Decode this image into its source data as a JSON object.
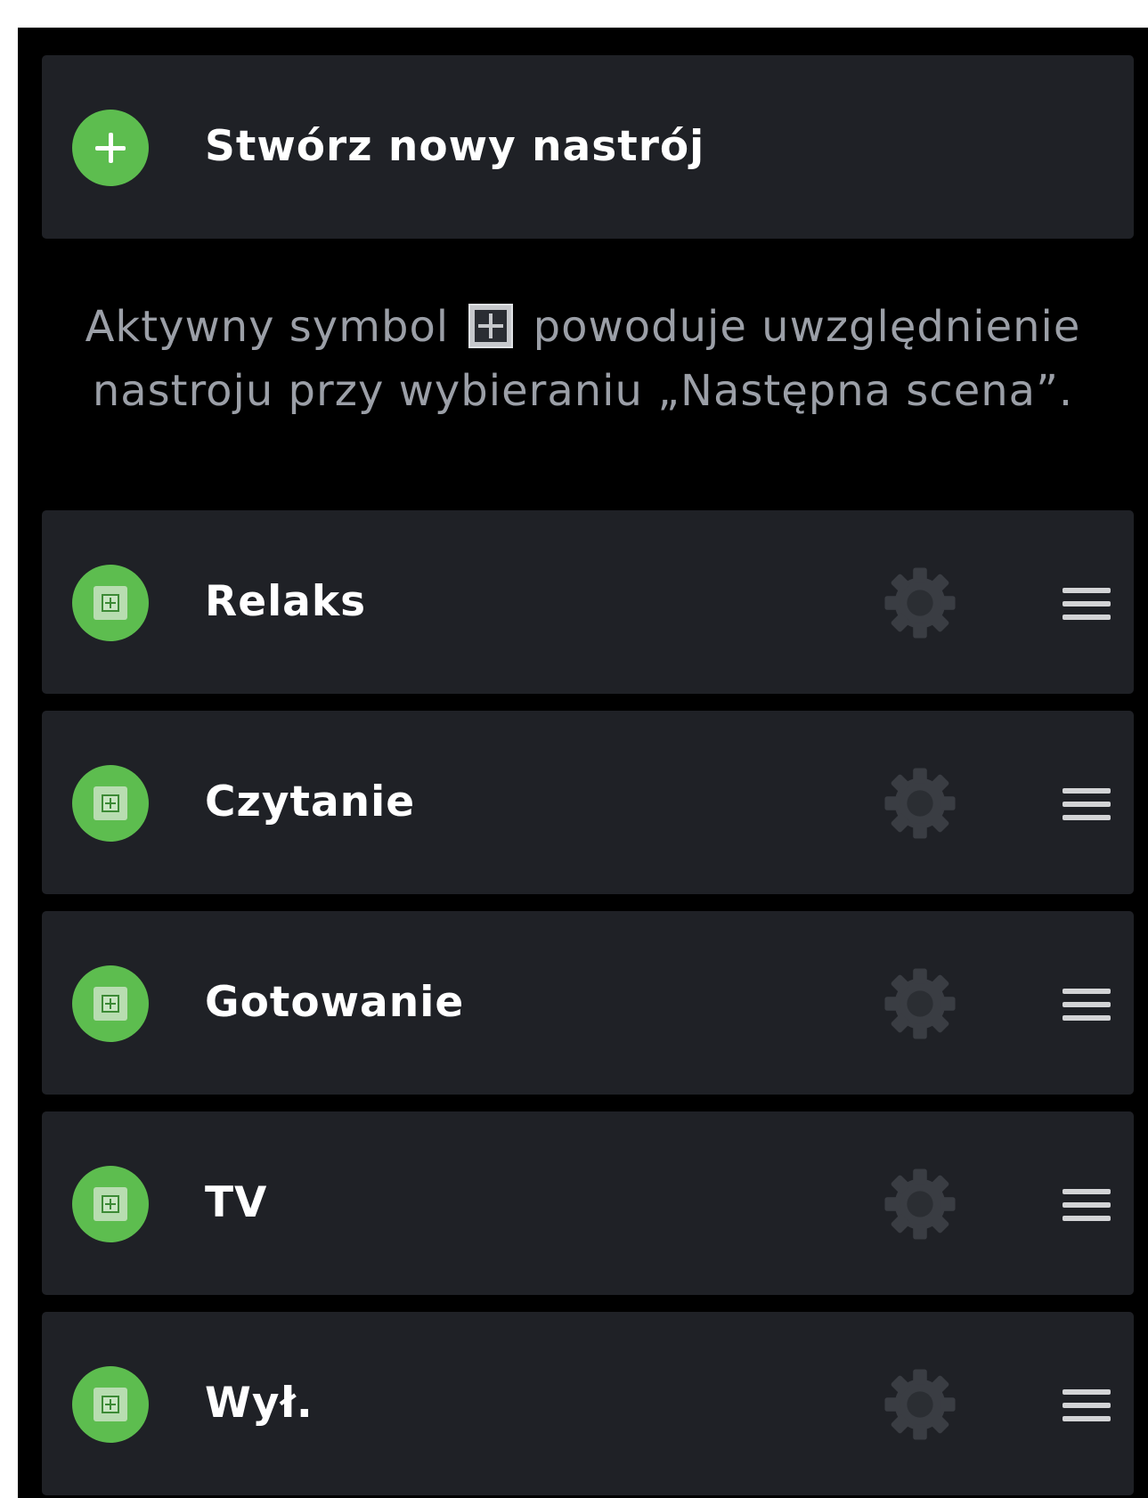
{
  "create": {
    "label": "Stwórz nowy nastrój"
  },
  "info": {
    "line1_before": "Aktywny symbol",
    "line1_after": "powoduje uwzględnienie",
    "line2": "nastroju przy wybieraniu „Następna scena”."
  },
  "moods": [
    {
      "label": "Relaks"
    },
    {
      "label": "Czytanie"
    },
    {
      "label": "Gotowanie"
    },
    {
      "label": "TV"
    },
    {
      "label": "Wył."
    }
  ],
  "colors": {
    "accent_green": "#5dbd4f",
    "card_background": "#1f2126",
    "screen_background": "#000000",
    "info_text": "#9b9fa7"
  },
  "icons": {
    "create": "plus-icon",
    "mood_include": "next-scene-include-icon",
    "settings": "gear-icon",
    "reorder": "drag-handle-icon"
  }
}
